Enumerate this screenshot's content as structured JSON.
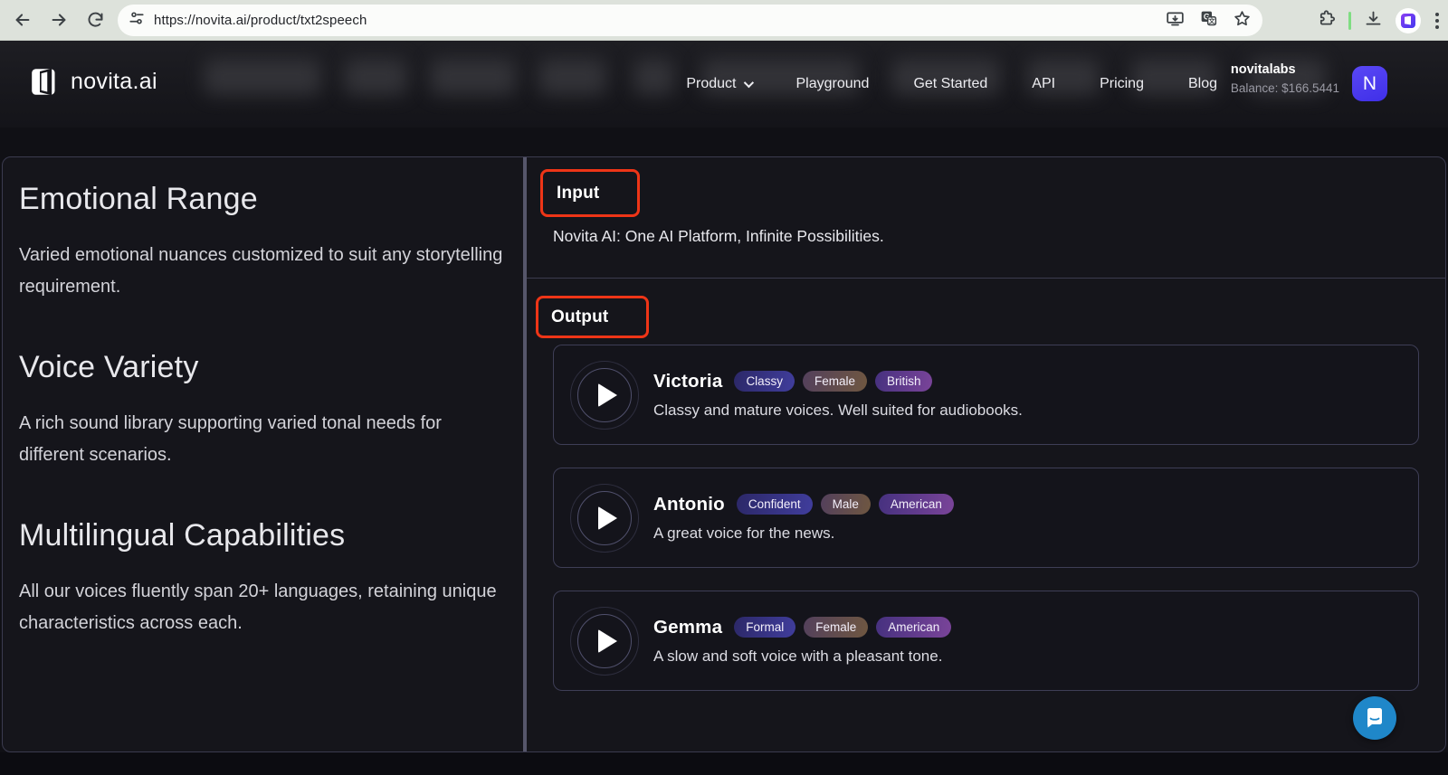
{
  "browser": {
    "url": "https://novita.ai/product/txt2speech",
    "icons": [
      "back",
      "forward",
      "reload",
      "site-info",
      "install",
      "translate",
      "bookmark-star",
      "extensions",
      "download",
      "profile",
      "menu"
    ]
  },
  "nav": {
    "brand": "novita.ai",
    "links": [
      {
        "label": "Product",
        "has_dropdown": true
      },
      {
        "label": "Playground"
      },
      {
        "label": "Get Started"
      },
      {
        "label": "API"
      },
      {
        "label": "Pricing"
      },
      {
        "label": "Blog"
      }
    ],
    "account": {
      "name": "novitalabs",
      "balance": "Balance: $166.5441",
      "avatar_letter": "N"
    }
  },
  "features": [
    {
      "title": "Emotional Range",
      "description": "Varied emotional nuances customized to suit any storytelling requirement."
    },
    {
      "title": "Voice Variety",
      "description": "A rich sound library supporting varied tonal needs for different scenarios."
    },
    {
      "title": "Multilingual Capabilities",
      "description": "All our voices fluently span 20+ languages, retaining unique characteristics across each."
    }
  ],
  "input_section": {
    "label": "Input",
    "text": "Novita AI: One AI Platform, Infinite Possibilities."
  },
  "output_section": {
    "label": "Output",
    "voices": [
      {
        "name": "Victoria",
        "tags": [
          "Classy",
          "Female",
          "British"
        ],
        "description": "Classy and mature voices. Well suited for audiobooks."
      },
      {
        "name": "Antonio",
        "tags": [
          "Confident",
          "Male",
          "American"
        ],
        "description": "A great voice for the news."
      },
      {
        "name": "Gemma",
        "tags": [
          "Formal",
          "Female",
          "American"
        ],
        "description": "A slow and soft voice with a pleasant tone."
      }
    ]
  },
  "colors": {
    "annotation_red": "#ee3517",
    "chat_blue": "#1f87c9",
    "avatar_purple": "#4338f0",
    "tag_indigo": "#403d9c",
    "tag_brown": "#6f5741",
    "tag_purple": "#7a4499"
  }
}
